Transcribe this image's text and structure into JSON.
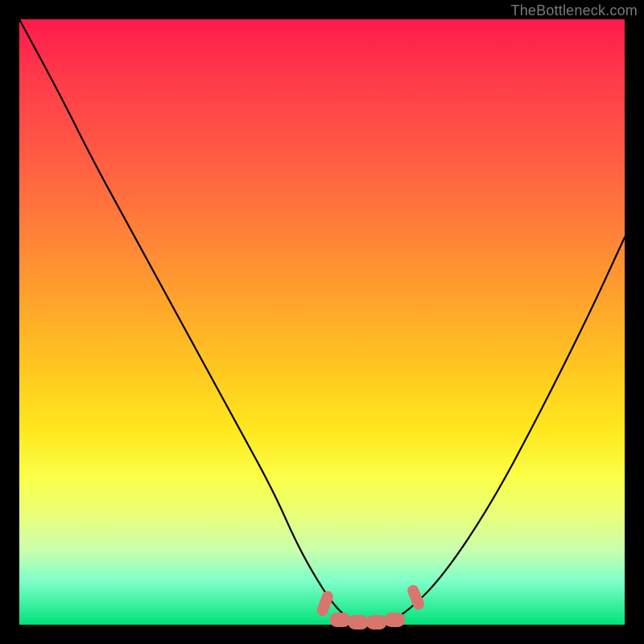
{
  "attribution": "TheBottleneck.com",
  "colors": {
    "frame": "#000000",
    "gradient_top": "#ff1a4d",
    "gradient_bottom": "#00e27a",
    "curve": "#000000",
    "markers": "#d8766d"
  },
  "chart_data": {
    "type": "line",
    "title": "",
    "xlabel": "",
    "ylabel": "",
    "xlim": [
      0,
      100
    ],
    "ylim": [
      0,
      100
    ],
    "series": [
      {
        "name": "bottleneck-curve",
        "x": [
          0,
          6,
          12,
          18,
          24,
          30,
          36,
          42,
          46,
          50,
          53,
          56,
          60,
          64,
          70,
          78,
          86,
          94,
          100
        ],
        "y": [
          100,
          89,
          77,
          66,
          55,
          44,
          33,
          22,
          13,
          6,
          2,
          0,
          0,
          2,
          8,
          20,
          35,
          51,
          64
        ]
      }
    ],
    "annotations": [
      {
        "name": "marker-left-edge",
        "x": 50.5,
        "y": 3.5
      },
      {
        "name": "marker-flat-1",
        "x": 53.0,
        "y": 0.8
      },
      {
        "name": "marker-flat-2",
        "x": 56.0,
        "y": 0.4
      },
      {
        "name": "marker-flat-3",
        "x": 59.0,
        "y": 0.4
      },
      {
        "name": "marker-flat-4",
        "x": 62.0,
        "y": 0.8
      },
      {
        "name": "marker-right-edge",
        "x": 65.5,
        "y": 4.5
      }
    ]
  }
}
